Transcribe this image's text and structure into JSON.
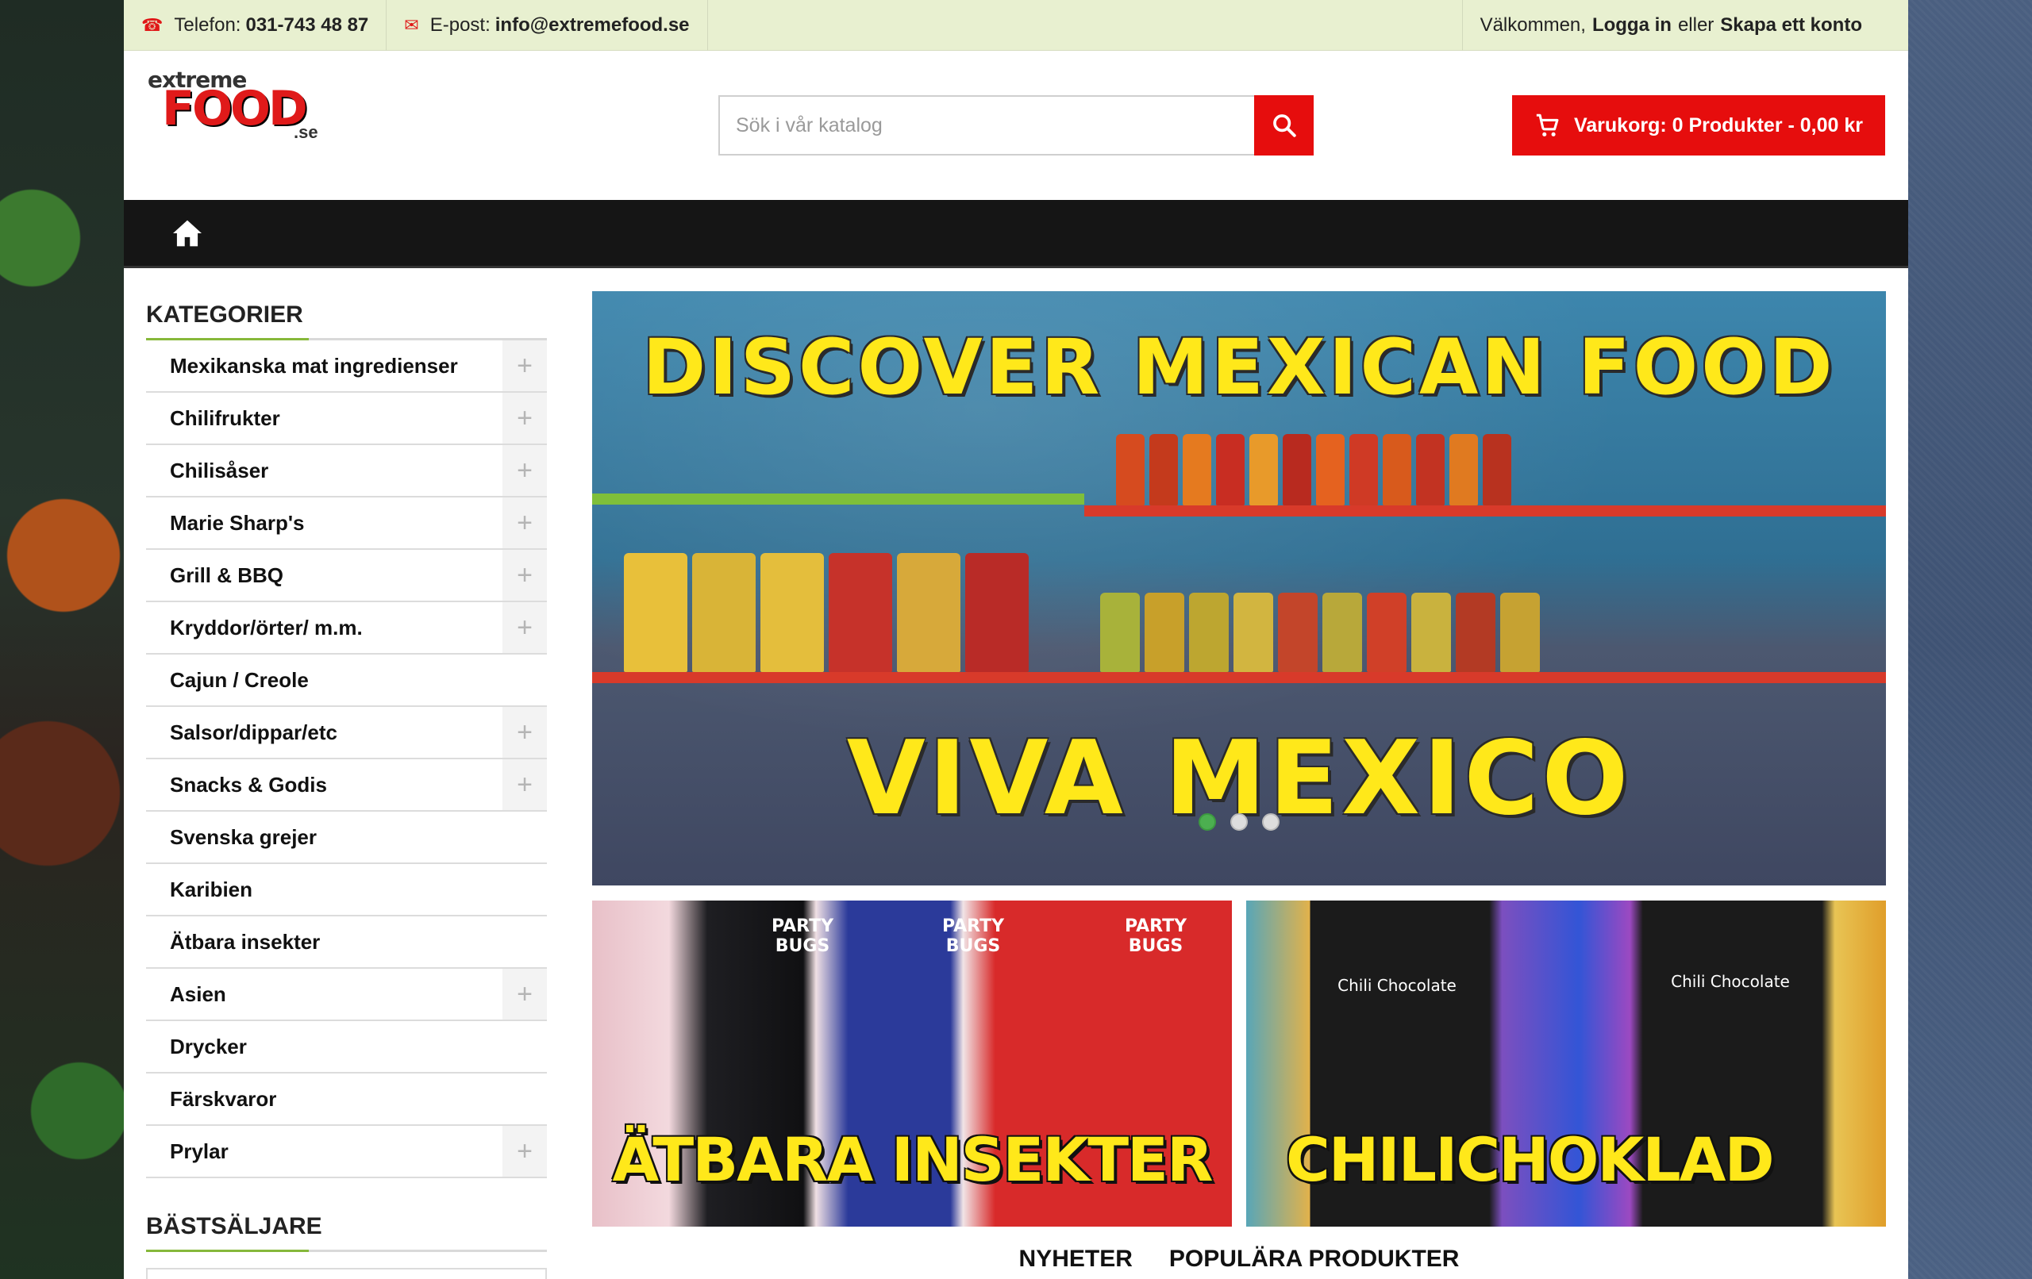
{
  "topbar": {
    "phone_label": "Telefon:",
    "phone": "031-743 48 87",
    "email_label": "E-post:",
    "email": "info@extremefood.se",
    "welcome": "Välkommen,",
    "login": "Logga in",
    "or": "eller",
    "register": "Skapa ett konto"
  },
  "logo": {
    "top": "extreme",
    "main": "FOOD",
    "suffix": ".se"
  },
  "search": {
    "placeholder": "Sök i vår katalog"
  },
  "cart": {
    "label": "Varukorg: 0 Produkter - 0,00 kr"
  },
  "sidebar": {
    "categories_title": "KATEGORIER",
    "categories": [
      {
        "label": "Mexikanska mat ingredienser",
        "expandable": true
      },
      {
        "label": "Chilifrukter",
        "expandable": true
      },
      {
        "label": "Chilisåser",
        "expandable": true
      },
      {
        "label": "Marie Sharp's",
        "expandable": true
      },
      {
        "label": "Grill & BBQ",
        "expandable": true
      },
      {
        "label": "Kryddor/örter/ m.m.",
        "expandable": true
      },
      {
        "label": "Cajun / Creole",
        "expandable": false
      },
      {
        "label": "Salsor/dippar/etc",
        "expandable": true
      },
      {
        "label": "Snacks & Godis",
        "expandable": true
      },
      {
        "label": "Svenska grejer",
        "expandable": false
      },
      {
        "label": "Karibien",
        "expandable": false
      },
      {
        "label": "Ätbara insekter",
        "expandable": false
      },
      {
        "label": "Asien",
        "expandable": true
      },
      {
        "label": "Drycker",
        "expandable": false
      },
      {
        "label": "Färskvaror",
        "expandable": false
      },
      {
        "label": "Prylar",
        "expandable": true
      }
    ],
    "bestsellers_title": "BÄSTSÄLJARE"
  },
  "slider": {
    "headline": "DISCOVER MEXICAN FOOD",
    "subline": "VIVA MEXICO",
    "active_slide": 1,
    "slide_count": 3
  },
  "banners": {
    "left": {
      "text": "ÄTBARA INSEKTER",
      "packs": [
        "PARTY BUGS",
        "PARTY BUGS",
        "PARTY BUGS"
      ]
    },
    "right": {
      "text": "CHILICHOKLAD",
      "packs": [
        "Chili Chocolate",
        "Chili Chocolate"
      ]
    }
  },
  "tabs": [
    "NYHETER",
    "POPULÄRA PRODUKTER"
  ],
  "colors": {
    "accent": "#e60d0d",
    "green": "#86b83a",
    "topbar": "#e8f0d0",
    "nav": "#151515"
  }
}
